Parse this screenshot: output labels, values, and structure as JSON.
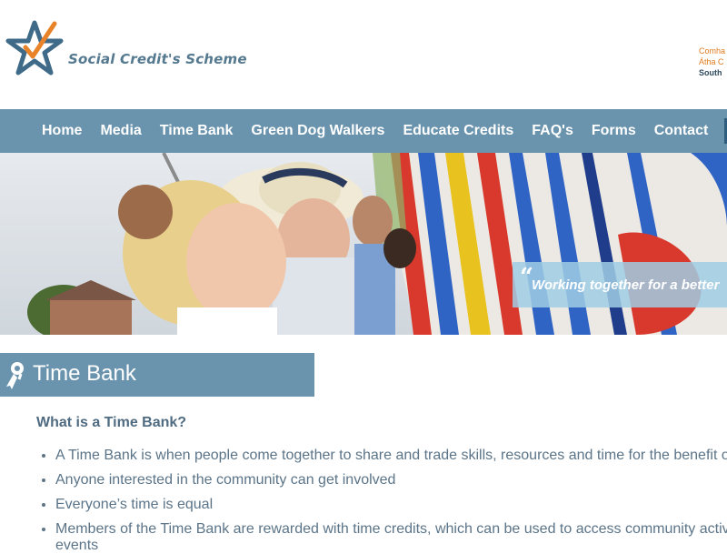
{
  "header": {
    "logo_text": "Social Credit's Scheme",
    "council_lines": [
      "Comha",
      "Átha C",
      "South"
    ]
  },
  "nav": {
    "items": [
      "Home",
      "Media",
      "Time Bank",
      "Green Dog Walkers",
      "Educate Credits",
      "FAQ's",
      "Forms",
      "Contact"
    ]
  },
  "hero": {
    "quote_mark": "“",
    "tagline": "Working together for a better"
  },
  "section": {
    "title": "Time Bank",
    "icon": "award-ribbon-icon"
  },
  "content": {
    "heading": "What is a Time Bank?",
    "bullets": [
      "A Time Bank is when people come together to share and trade skills, resources and time for the benefit of e",
      "Anyone interested in the community can get involved",
      "Everyone’s time is equal",
      "Members of the Time Bank are rewarded with time credits, which can be used to access community activitie",
      "events"
    ]
  },
  "colors": {
    "nav_bg": "#6a93ad",
    "logo_blue": "#3f6a88",
    "logo_orange": "#e8832a",
    "text": "#5b7488"
  }
}
